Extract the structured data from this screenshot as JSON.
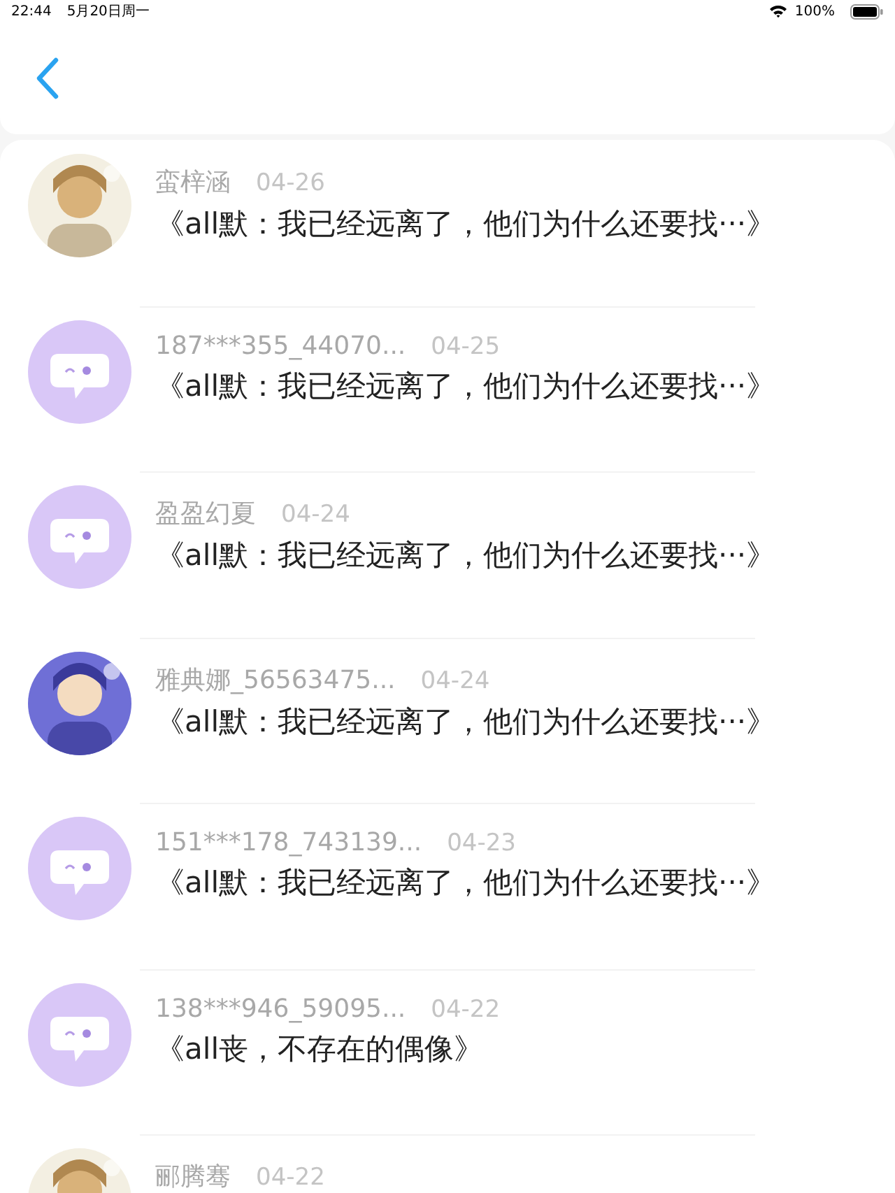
{
  "status_bar": {
    "time": "22:44",
    "date": "5月20日周一",
    "battery": "100%"
  },
  "messages": [
    {
      "name": "蛮梓涵",
      "date": "04-26",
      "text": "《all默：我已经远离了，他们为什么还要找···》"
    },
    {
      "avatar": {
        "kind": "default"
      },
      "name": "187***355_44070...",
      "date": "04-25",
      "text": "《all默：我已经远离了，他们为什么还要找···》"
    },
    {
      "avatar": {
        "kind": "default"
      },
      "name": "盈盈幻夏",
      "date": "04-24",
      "text": "《all默：我已经远离了，他们为什么还要找···》"
    },
    {
      "name": "雅典娜_56563475...",
      "date": "04-24",
      "text": "《all默：我已经远离了，他们为什么还要找···》"
    },
    {
      "avatar": {
        "kind": "default"
      },
      "name": "151***178_743139...",
      "date": "04-23",
      "text": "《all默：我已经远离了，他们为什么还要找···》"
    },
    {
      "avatar": {
        "kind": "default"
      },
      "name": "138***946_59095...",
      "date": "04-22",
      "text": "《all丧，不存在的偶像》"
    },
    {
      "name": "郦腾骞",
      "date": "04-22"
    }
  ]
}
